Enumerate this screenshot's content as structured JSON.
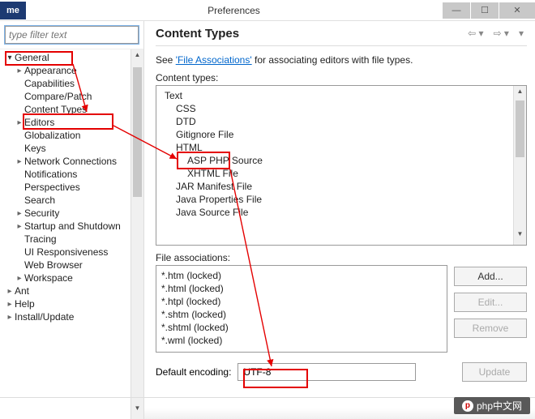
{
  "titlebar": {
    "me": "me",
    "title": "Preferences"
  },
  "filter": {
    "placeholder": "type filter text"
  },
  "left_tree": {
    "root": "General",
    "children1": [
      {
        "label": "Appearance",
        "exp": "closed"
      },
      {
        "label": "Capabilities",
        "exp": "none"
      },
      {
        "label": "Compare/Patch",
        "exp": "none"
      },
      {
        "label": "Content Types",
        "exp": "none"
      },
      {
        "label": "Editors",
        "exp": "closed"
      },
      {
        "label": "Globalization",
        "exp": "none"
      },
      {
        "label": "Keys",
        "exp": "none"
      },
      {
        "label": "Network Connections",
        "exp": "closed"
      },
      {
        "label": "Notifications",
        "exp": "none"
      },
      {
        "label": "Perspectives",
        "exp": "none"
      },
      {
        "label": "Search",
        "exp": "none"
      },
      {
        "label": "Security",
        "exp": "closed"
      },
      {
        "label": "Startup and Shutdown",
        "exp": "closed"
      },
      {
        "label": "Tracing",
        "exp": "none"
      },
      {
        "label": "UI Responsiveness",
        "exp": "none"
      },
      {
        "label": "Web Browser",
        "exp": "none"
      },
      {
        "label": "Workspace",
        "exp": "closed"
      }
    ],
    "siblings": [
      {
        "label": "Ant",
        "exp": "closed"
      },
      {
        "label": "Help",
        "exp": "closed"
      },
      {
        "label": "Install/Update",
        "exp": "closed"
      }
    ]
  },
  "right": {
    "heading": "Content Types",
    "see_prefix": "See ",
    "see_link": "'File Associations'",
    "see_suffix": " for associating editors with file types.",
    "ct_label": "Content types:",
    "ct_tree": {
      "root": "Text",
      "level1": [
        {
          "label": "CSS",
          "exp": "none"
        },
        {
          "label": "DTD",
          "exp": "none"
        },
        {
          "label": "Gitignore File",
          "exp": "none"
        },
        {
          "label": "HTML",
          "exp": "open",
          "children": [
            {
              "label": "ASP PHP Source",
              "exp": "none"
            },
            {
              "label": "XHTML File",
              "exp": "closed"
            }
          ]
        },
        {
          "label": "JAR Manifest File",
          "exp": "closed"
        },
        {
          "label": "Java Properties File",
          "exp": "closed"
        },
        {
          "label": "Java Source File",
          "exp": "closed"
        }
      ]
    },
    "fa_label": "File associations:",
    "fa_items": [
      "*.htm (locked)",
      "*.html (locked)",
      "*.htpl (locked)",
      "*.shtm (locked)",
      "*.shtml (locked)",
      "*.wml (locked)"
    ],
    "buttons": {
      "add": "Add...",
      "edit": "Edit...",
      "remove": "Remove",
      "update": "Update"
    },
    "enc_label": "Default encoding:",
    "enc_value": "UTF-8"
  },
  "watermark": "php中文网"
}
